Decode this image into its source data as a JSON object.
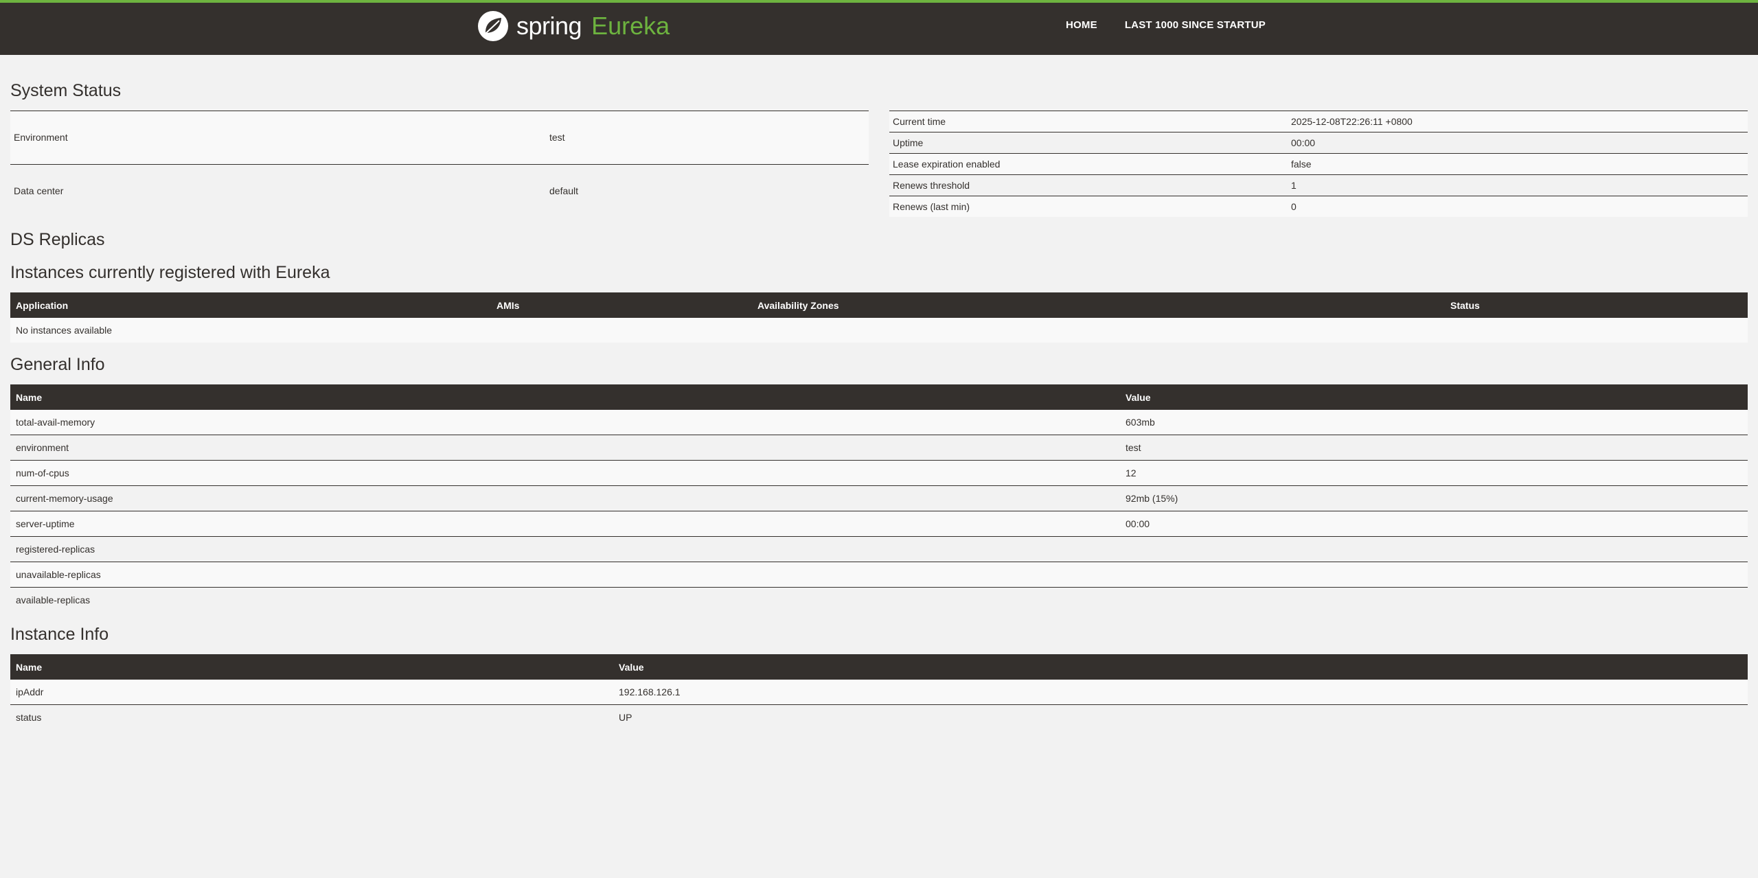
{
  "brand": {
    "spring": "spring",
    "eureka": "Eureka"
  },
  "nav": {
    "home": "HOME",
    "last1000": "LAST 1000 SINCE STARTUP"
  },
  "system_status": {
    "title": "System Status",
    "left": [
      {
        "k": "Environment",
        "v": "test"
      },
      {
        "k": "Data center",
        "v": "default"
      }
    ],
    "right": [
      {
        "k": "Current time",
        "v": "2025-12-08T22:26:11 +0800"
      },
      {
        "k": "Uptime",
        "v": "00:00"
      },
      {
        "k": "Lease expiration enabled",
        "v": "false"
      },
      {
        "k": "Renews threshold",
        "v": "1"
      },
      {
        "k": "Renews (last min)",
        "v": "0"
      }
    ]
  },
  "ds_replicas": {
    "title": "DS Replicas"
  },
  "instances": {
    "title": "Instances currently registered with Eureka",
    "headers": [
      "Application",
      "AMIs",
      "Availability Zones",
      "Status"
    ],
    "empty": "No instances available"
  },
  "general_info": {
    "title": "General Info",
    "headers": [
      "Name",
      "Value"
    ],
    "rows": [
      [
        "total-avail-memory",
        "603mb"
      ],
      [
        "environment",
        "test"
      ],
      [
        "num-of-cpus",
        "12"
      ],
      [
        "current-memory-usage",
        "92mb (15%)"
      ],
      [
        "server-uptime",
        "00:00"
      ],
      [
        "registered-replicas",
        ""
      ],
      [
        "unavailable-replicas",
        ""
      ],
      [
        "available-replicas",
        ""
      ]
    ]
  },
  "instance_info": {
    "title": "Instance Info",
    "headers": [
      "Name",
      "Value"
    ],
    "rows": [
      [
        "ipAddr",
        "192.168.126.1"
      ],
      [
        "status",
        "UP"
      ]
    ]
  },
  "colors": {
    "header_bg": "#34302d",
    "accent_green": "#6db33f",
    "page_bg": "#f2f2f2"
  }
}
